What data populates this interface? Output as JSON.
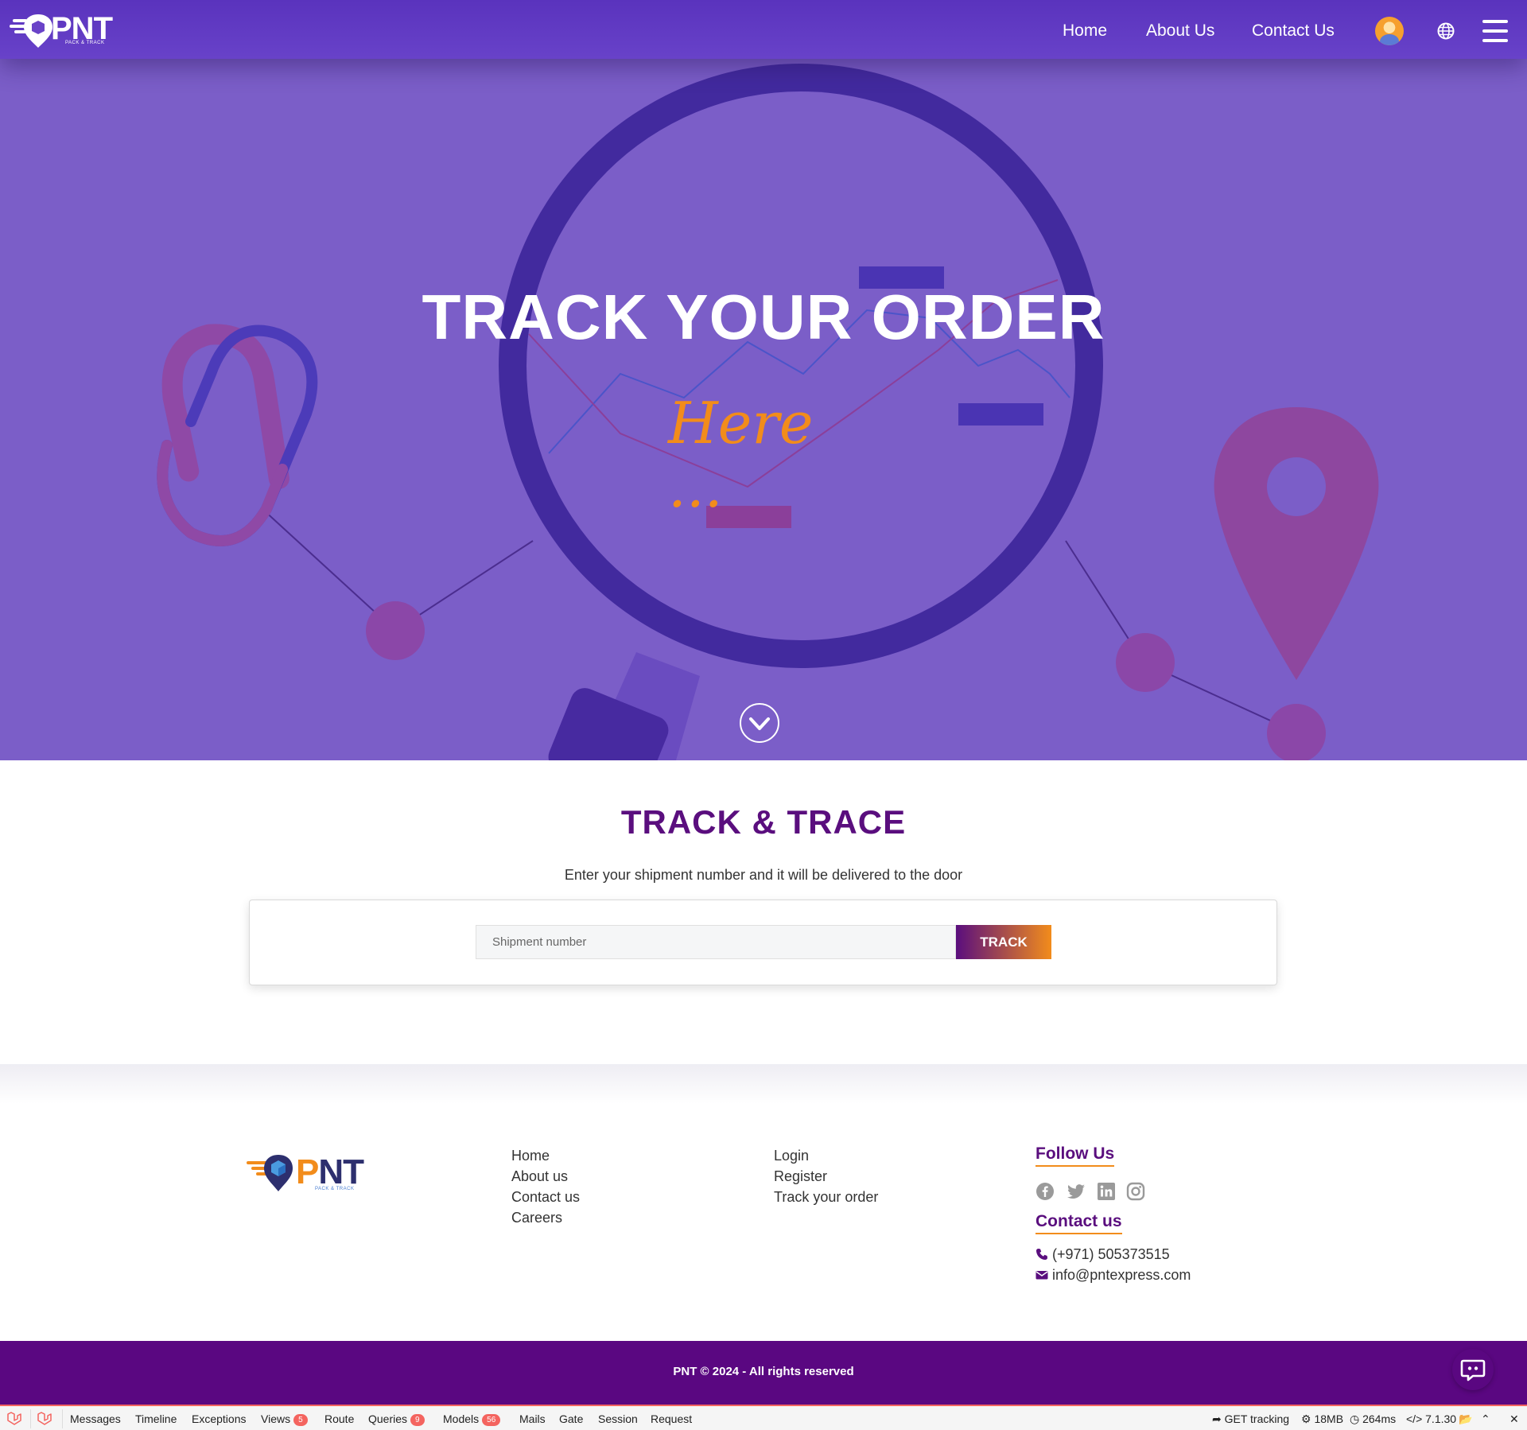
{
  "navbar": {
    "logo_text": "PNT",
    "logo_sub": "PACK & TRACK",
    "links": [
      "Home",
      "About Us",
      "Contact Us"
    ]
  },
  "hero": {
    "title": "TRACK YOUR ORDER",
    "subtitle": "Here ..."
  },
  "track": {
    "title": "TRACK & TRACE",
    "description": "Enter your shipment number and it will be delivered to the door",
    "input_placeholder": "Shipment number",
    "button_label": "TRACK"
  },
  "footer": {
    "logo_text_p": "P",
    "logo_text_nt": "NT",
    "logo_sub": "PACK & TRACK",
    "col1": [
      "Home",
      "About us",
      "Contact us",
      "Careers"
    ],
    "col2": [
      "Login",
      "Register",
      "Track your order"
    ],
    "follow_title": "Follow Us",
    "socials": [
      "facebook-icon",
      "twitter-icon",
      "linkedin-icon",
      "instagram-icon"
    ],
    "contact_title": "Contact us",
    "phone": "(+971) 505373515",
    "email": "info@pntexpress.com",
    "copyright": "PNT © 2024 - All rights reserved"
  },
  "debugbar": {
    "tabs": [
      "Messages",
      "Timeline",
      "Exceptions",
      "Views",
      "Route",
      "Queries",
      "Models",
      "Mails",
      "Gate",
      "Session",
      "Request"
    ],
    "badges": {
      "views": "5",
      "queries": "9",
      "models": "56"
    },
    "route": "GET tracking",
    "memory": "18MB",
    "time": "264ms",
    "version": "7.1.30"
  },
  "colors": {
    "nav": "#5a33bd",
    "hero_bg": "#7b5ec8",
    "brand_purple": "#5a0e7e",
    "accent_orange": "#f28c1b"
  }
}
